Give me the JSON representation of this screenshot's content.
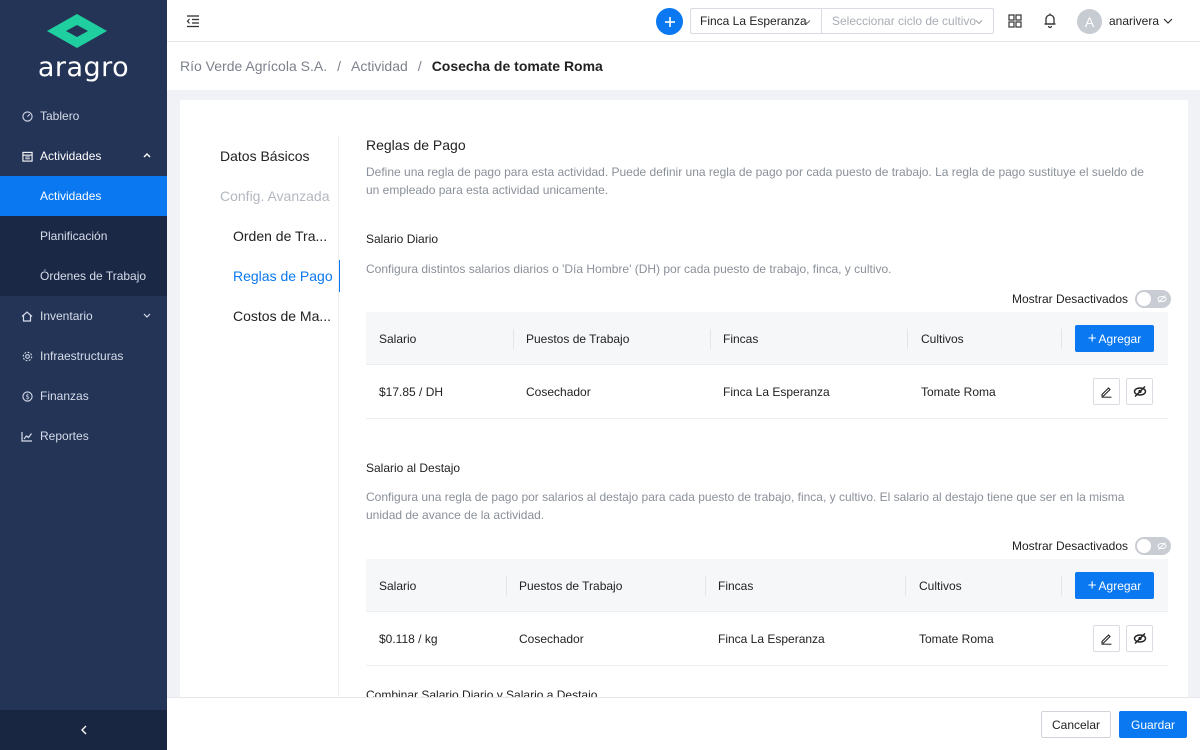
{
  "brand": {
    "name": "aragro",
    "accent": "#0A78F0",
    "logo_color": "#1FCF9F"
  },
  "sidebar": {
    "items": [
      {
        "label": "Tablero",
        "icon": "gauge-icon"
      },
      {
        "label": "Actividades",
        "icon": "calendar-icon",
        "expanded": true
      },
      {
        "label": "Actividades",
        "active": true
      },
      {
        "label": "Planificación"
      },
      {
        "label": "Órdenes de Trabajo"
      },
      {
        "label": "Inventario",
        "icon": "home-icon"
      },
      {
        "label": "Infraestructuras",
        "icon": "gear-icon"
      },
      {
        "label": "Finanzas",
        "icon": "dollar-icon"
      },
      {
        "label": "Reportes",
        "icon": "chart-icon"
      }
    ]
  },
  "header": {
    "farm": "Finca La Esperanza",
    "cycle_placeholder": "Seleccionar ciclo de cultivo",
    "avatar_initial": "A",
    "username": "anarivera"
  },
  "breadcrumb": {
    "org": "Río Verde Agrícola S.A.",
    "section": "Actividad",
    "current": "Cosecha de tomate Roma",
    "separator": "/"
  },
  "subnav": {
    "items": [
      {
        "label": "Datos Básicos"
      },
      {
        "label": "Config. Avanzada",
        "disabled": true
      },
      {
        "label": "Orden de Tra..."
      },
      {
        "label": "Reglas de Pago",
        "active": true
      },
      {
        "label": "Costos de Ma..."
      }
    ]
  },
  "payment_rules": {
    "title": "Reglas de Pago",
    "description": "Define una regla de pago para esta actividad. Puede definir una regla de pago por cada puesto de trabajo. La regla de pago sustituye el sueldo de un empleado para esta actividad unicamente.",
    "show_disabled_label": "Mostrar Desactivados",
    "add_label": "Agregar",
    "daily": {
      "title": "Salario Diario",
      "description": "Configura distintos salarios diarios o 'Día Hombre' (DH) por cada puesto de trabajo, finca, y cultivo.",
      "columns": [
        "Salario",
        "Puestos de Trabajo",
        "Fincas",
        "Cultivos"
      ],
      "rows": [
        {
          "salary": "$17.85 / DH",
          "position": "Cosechador",
          "farm": "Finca La Esperanza",
          "crop": "Tomate Roma"
        }
      ]
    },
    "piece": {
      "title": "Salario al Destajo",
      "description": "Configura una regla de pago por salarios al destajo para cada puesto de trabajo, finca, y cultivo. El salario al destajo tiene que ser en la misma unidad de avance de la actividad.",
      "columns": [
        "Salario",
        "Puestos de Trabajo",
        "Fincas",
        "Cultivos"
      ],
      "rows": [
        {
          "salary": "$0.118 / kg",
          "position": "Cosechador",
          "farm": "Finca La Esperanza",
          "crop": "Tomate Roma"
        }
      ]
    },
    "combine_title": "Combinar Salario Diario y Salario a Destajo"
  },
  "footer": {
    "cancel_label": "Cancelar",
    "save_label": "Guardar"
  }
}
